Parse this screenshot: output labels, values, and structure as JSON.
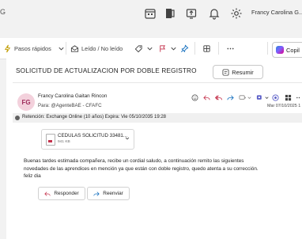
{
  "topbar": {
    "user_name": "Francy Carolina G...",
    "left_fragment": "G",
    "icons": [
      "calendar-mini-icon",
      "office-icon",
      "share-icon",
      "bell-icon",
      "settings-icon"
    ]
  },
  "toolbar": {
    "quick_steps_label": "Pasos rápidos",
    "read_unread_label": "Leído / No leído",
    "copilot_label": "Copil",
    "colors": {
      "quick_steps_icon": "#c19c00",
      "flag_icon": "#c4314b",
      "tag_icon": "#0f6cbd"
    }
  },
  "message": {
    "subject": "SOLICITUD DE ACTUALIZACION  POR DOBLE REGISTRO",
    "summarize_label": "Resumir",
    "sender_name": "Francy Carolina Gaitan Rincon",
    "avatar_initials": "FG",
    "to_line": "Para:  @AgenteBAE - CFAFC",
    "date": "Mar 07/10/2025 1",
    "retention": "Retención: Exchange Online (10 años) Expira: Vie 05/10/2035 19:28",
    "attachment": {
      "name": "CEDULAS SOLICITUD 33481...",
      "size": "941 KB"
    },
    "body_lines": [
      "Buenas tardes estimada compañera, recibe un cordial saludo, a continuación remito  las siguientes",
      "novedades de las  aprendices en mención ya que están con doble registro,  quedo atenta a  su  corrección.",
      "feliz dia"
    ],
    "reply_label": "Responder",
    "forward_label": "Reenviar"
  }
}
